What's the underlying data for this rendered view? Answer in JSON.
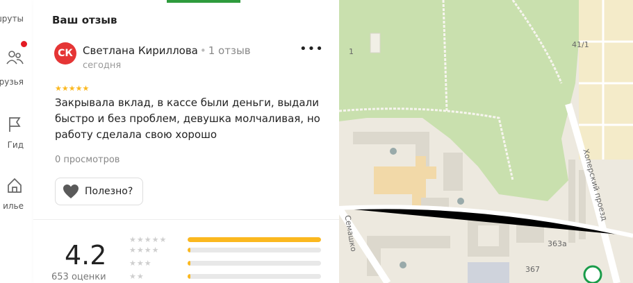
{
  "nav": {
    "items": [
      {
        "label": "ошруты",
        "icon": "route-icon"
      },
      {
        "label": "рузья",
        "icon": "friends-icon"
      },
      {
        "label": "Гид",
        "icon": "flag-icon"
      },
      {
        "label": "илье",
        "icon": "housing-icon"
      }
    ]
  },
  "review": {
    "section_title": "Ваш отзыв",
    "avatar_initials": "СК",
    "author": "Светлана Кириллова",
    "separator": "•",
    "reviews_count": "1 отзыв",
    "date": "сегодня",
    "rating_stars": "★★★★★",
    "text": "Закрывала вклад, в кассе были деньги, выдали быстро и без проблем, девушка молчаливая, но работу сделала свою хорошо",
    "views": "0 просмотров",
    "helpful_label": "Полезно?",
    "more_label": "•••"
  },
  "rating": {
    "value": "4.2",
    "count": "653 оценки",
    "distribution": [
      {
        "stars": "★★★★★",
        "fraction": 1.0
      },
      {
        "stars": "★★★★",
        "fraction": 0.02
      },
      {
        "stars": "★★★",
        "fraction": 0.02
      },
      {
        "stars": "★★",
        "fraction": 0.02
      }
    ]
  },
  "map": {
    "labels": {
      "house_41_1": "41/1",
      "street_khopersky": "Хоперский проезд",
      "street_semashko": "Семашко",
      "house_363a": "363а",
      "house_367": "367",
      "house_1": "1"
    },
    "colors": {
      "park": "#c9e0ae",
      "land": "#ede9df",
      "building": "#dcd8cd",
      "hospital": "#f2d9a8"
    }
  },
  "colors": {
    "accent_green": "#2e9b3d",
    "star": "#fbb81f",
    "avatar": "#e53535",
    "notification": "#e31b23"
  }
}
